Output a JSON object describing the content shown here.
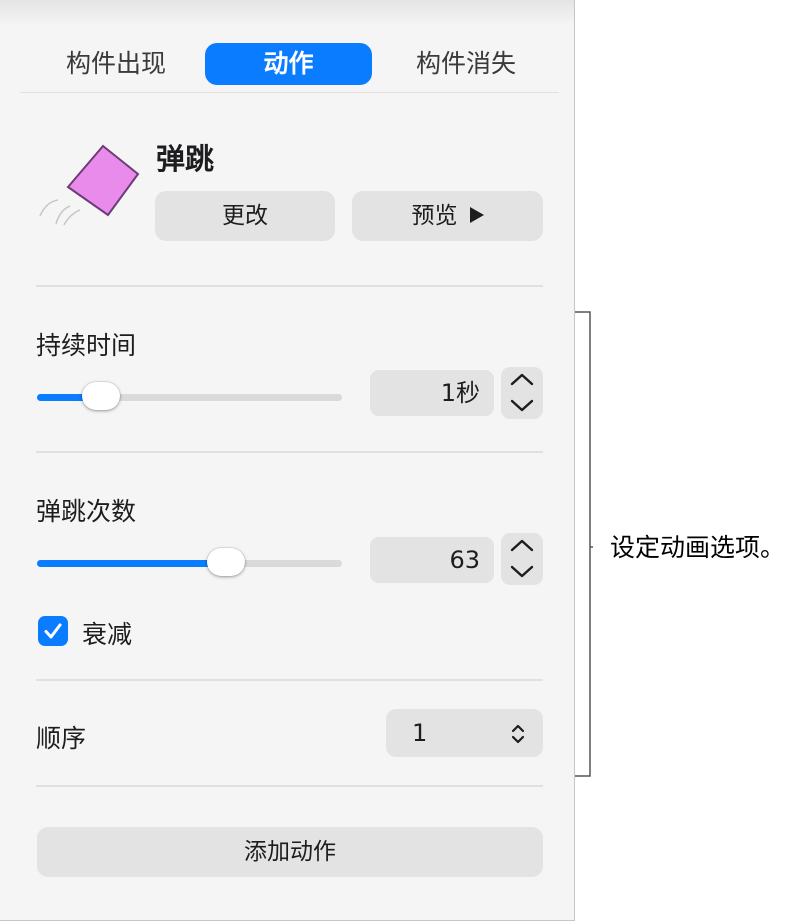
{
  "tabs": [
    {
      "label": "构件出现",
      "active": false
    },
    {
      "label": "动作",
      "active": true
    },
    {
      "label": "构件消失",
      "active": false
    }
  ],
  "effect": {
    "name": "弹跳",
    "icon": "bounce-diamond-icon",
    "change_label": "更改",
    "preview_label": "预览"
  },
  "duration": {
    "label": "持续时间",
    "value": "1秒",
    "slider_fraction": 0.21
  },
  "bounces": {
    "label": "弹跳次数",
    "value": "63",
    "slider_fraction": 0.62
  },
  "decay": {
    "label": "衰减",
    "checked": true
  },
  "order": {
    "label": "顺序",
    "value": "1"
  },
  "add_action_label": "添加动作",
  "callout": {
    "text": "设定动画选项。"
  },
  "colors": {
    "accent": "#0a7cff",
    "panel_bg": "#f5f5f5",
    "control_bg": "#e3e3e3",
    "diamond_fill": "#e98bea"
  }
}
